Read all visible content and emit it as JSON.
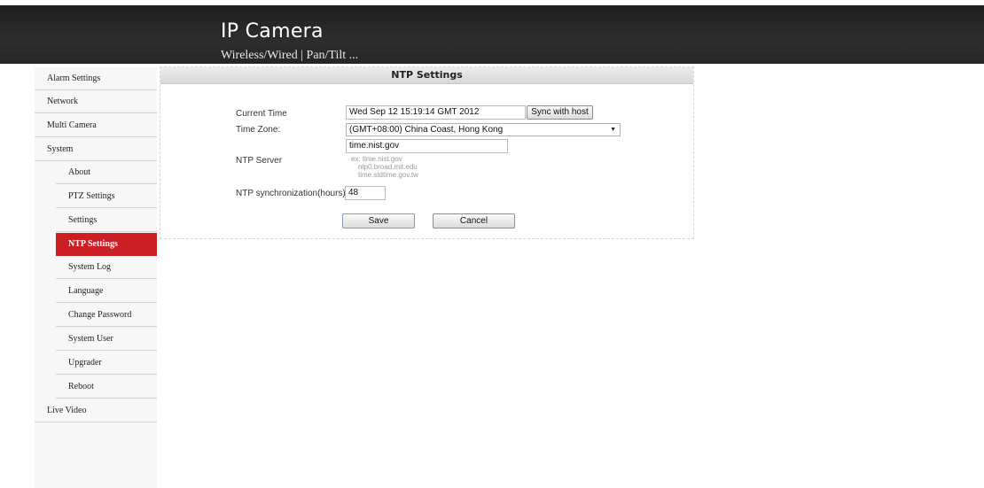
{
  "header": {
    "title": "IP Camera",
    "subnav": "Wireless/Wired | Pan/Tilt ..."
  },
  "sidebar": {
    "items": [
      {
        "label": "Alarm Settings"
      },
      {
        "label": "Network"
      },
      {
        "label": "Multi Camera"
      },
      {
        "label": "System"
      },
      {
        "label": "About"
      },
      {
        "label": "PTZ Settings"
      },
      {
        "label": "Settings"
      },
      {
        "label": "NTP Settings"
      },
      {
        "label": "System Log"
      },
      {
        "label": "Language"
      },
      {
        "label": "Change Password"
      },
      {
        "label": "System User"
      },
      {
        "label": "Upgrader"
      },
      {
        "label": "Reboot"
      },
      {
        "label": "Live Video"
      }
    ],
    "active_color": "#cc1f25"
  },
  "ntp": {
    "title": "NTP Settings",
    "current_time_label": "Current Time",
    "current_time_value": "Wed Sep 12 15:19:14 GMT 2012",
    "sync_button": "Sync with host",
    "timezone_label": "Time Zone:",
    "timezone_value": "(GMT+08:00) China Coast, Hong Kong",
    "ntp_server_label": "NTP Server",
    "ntp_server_value": "time.nist.gov",
    "hint_1": "ex: time.nist.gov",
    "hint_2": "ntp0.broad.mit.edu",
    "hint_3": "time.stdtime.gov.tw",
    "sync_hours_label": "NTP synchronization(hours)",
    "sync_hours_value": "48",
    "save_button": "Save",
    "cancel_button": "Cancel"
  }
}
